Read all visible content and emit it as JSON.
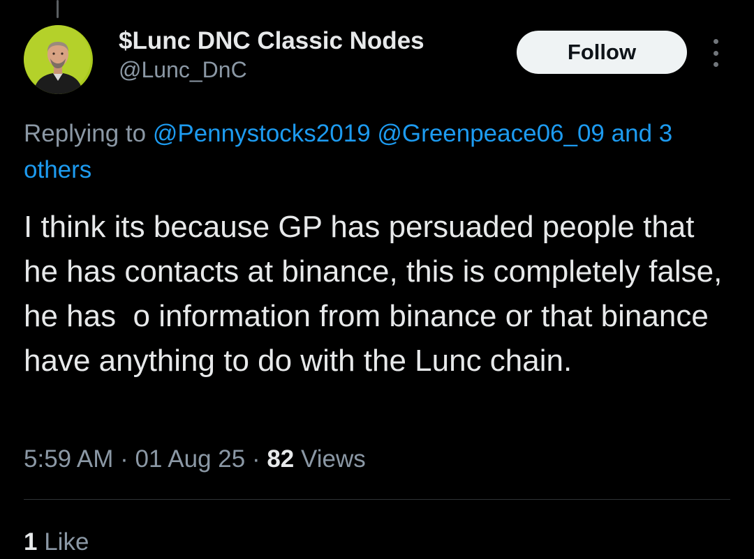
{
  "author": {
    "display_name": "$Lunc DNC Classic Nodes",
    "handle": "@Lunc_DnC",
    "follow_label": "Follow"
  },
  "reply_context": {
    "prefix": "Replying to",
    "mentions": [
      "@Pennystocks2019",
      "@Greenpeace06_09"
    ],
    "others": "and 3 others"
  },
  "tweet": {
    "text": "I think its because GP has persuaded people that he has contacts at binance, this is completely false, he has  o information from binance or that binance have anything to do with the Lunc chain."
  },
  "meta": {
    "time": "5:59 AM",
    "separator": "·",
    "date": "01 Aug 25",
    "views_count": "82",
    "views_label": "Views"
  },
  "engagement": {
    "like_count": "1",
    "like_label": "Like"
  },
  "colors": {
    "background": "#000000",
    "text_primary": "#e7e9ea",
    "text_secondary": "#8b98a5",
    "link": "#1d9bf0",
    "follow_bg": "#eff3f4",
    "avatar_bg": "#a9c91d"
  },
  "icons": {
    "more": "more-vertical-icon",
    "avatar": "avatar"
  }
}
